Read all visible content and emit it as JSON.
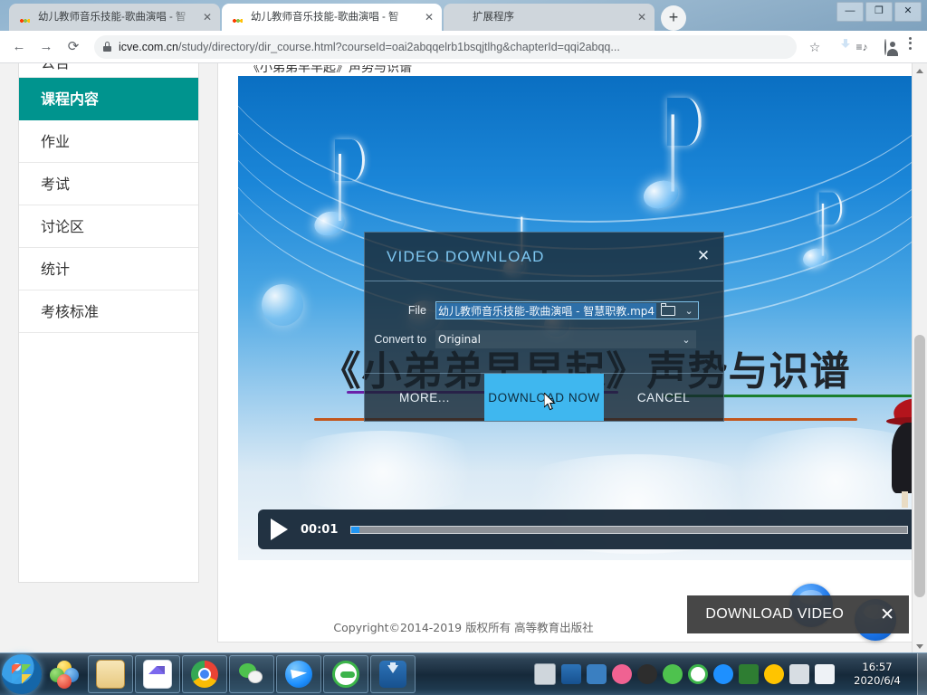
{
  "browser": {
    "tabs": [
      {
        "title": "幼儿教师音乐技能-歌曲演唱 - 智",
        "icon": "site-icon",
        "close": "✕",
        "active": false
      },
      {
        "title": "幼儿教师音乐技能-歌曲演唱 - 智",
        "icon": "site-icon",
        "close": "✕",
        "active": true
      },
      {
        "title": "扩展程序",
        "icon": "puzzle-icon",
        "close": "✕",
        "active": false
      }
    ],
    "new_tab_label": "+",
    "window_controls": {
      "minimize": "—",
      "maximize": "❐",
      "close": "✕"
    },
    "nav": {
      "back": "←",
      "forward": "→",
      "reload": "⟳"
    },
    "omnibox": {
      "url_host": "icve.com.cn",
      "url_path": "/study/directory/dir_course.html?courseId=oai2abqqelrb1bsqjtlhg&chapterId=qqi2abqq...",
      "lock_title": "secure"
    },
    "toolbar_right": {
      "bookmark": "☆",
      "extension": "extension-icon",
      "reading_list": "≡♪",
      "profile": "profile-icon",
      "menu": "⋮"
    }
  },
  "sidebar": {
    "items": [
      {
        "label": "公告",
        "active": false
      },
      {
        "label": "课程内容",
        "active": true
      },
      {
        "label": "作业",
        "active": false
      },
      {
        "label": "考试",
        "active": false
      },
      {
        "label": "讨论区",
        "active": false
      },
      {
        "label": "统计",
        "active": false
      },
      {
        "label": "考核标准",
        "active": false
      }
    ],
    "active_color": "#00948e"
  },
  "content": {
    "lesson_title": "《小弟弟早早起》声势与识谱",
    "video_overlay_title": "《小弟弟早早起》声势与识谱",
    "player": {
      "play_label": "play-button",
      "current_time": "00:01",
      "progress_percent": 1.4
    },
    "footer_copyright": "Copyright©2014-2019 版权所有 高等教育出版社"
  },
  "download_banner": {
    "label": "DOWNLOAD VIDEO",
    "close": "✕"
  },
  "idm_dialog": {
    "title": "VIDEO DOWNLOAD",
    "close": "✕",
    "file_label": "File",
    "file_value": "幼儿教师音乐技能-歌曲演唱 - 智慧职教.mp4",
    "folder_icon": "folder-icon",
    "file_dropdown": "⌄",
    "convert_label": "Convert to",
    "convert_value": "Original",
    "convert_dropdown": "⌄",
    "buttons": {
      "more": "MORE...",
      "download_now": "DOWNLOAD NOW",
      "cancel": "CANCEL"
    },
    "highlight_color": "#3fb7ef"
  },
  "taskbar": {
    "start": "start-orb",
    "apps": [
      {
        "name": "aero-peek"
      },
      {
        "name": "file-explorer"
      },
      {
        "name": "foxmail"
      },
      {
        "name": "google-chrome"
      },
      {
        "name": "wechat"
      },
      {
        "name": "qq-mail"
      },
      {
        "name": "360-browser"
      },
      {
        "name": "idm-downloader"
      }
    ],
    "tray": [
      {
        "name": "keyboard-input"
      },
      {
        "name": "idm-tray"
      },
      {
        "name": "virtualbox-tray"
      },
      {
        "name": "sogou-input"
      },
      {
        "name": "baidu-tray"
      },
      {
        "name": "wechat-tray"
      },
      {
        "name": "360-tray"
      },
      {
        "name": "qq-tray"
      },
      {
        "name": "wps-tray"
      },
      {
        "name": "plus-tray"
      },
      {
        "name": "network-tray"
      },
      {
        "name": "volume-tray"
      }
    ],
    "clock_time": "16:57",
    "clock_date": "2020/6/4"
  }
}
